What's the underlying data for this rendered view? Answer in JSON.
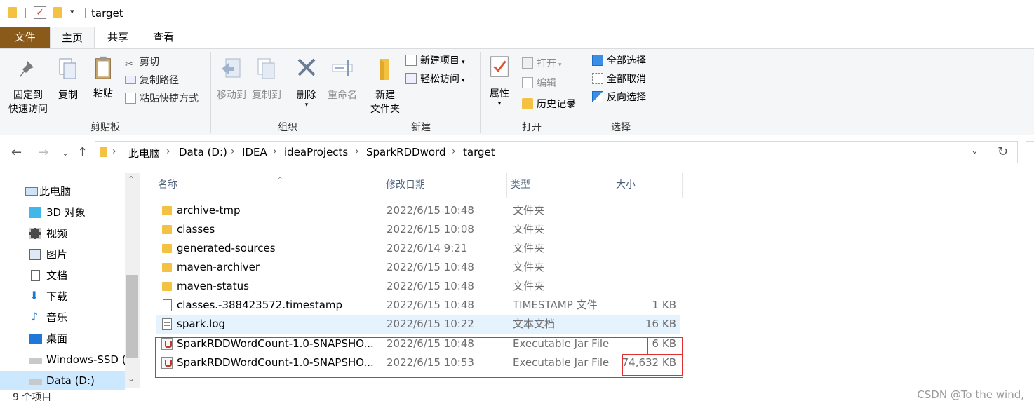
{
  "window": {
    "title": "target"
  },
  "ribbon_tabs": {
    "file": "文件",
    "home": "主页",
    "share": "共享",
    "view": "查看"
  },
  "ribbon": {
    "clipboard": {
      "group_label": "剪贴板",
      "pin_line1": "固定到",
      "pin_line2": "快速访问",
      "copy": "复制",
      "paste": "粘贴",
      "cut": "剪切",
      "copy_path": "复制路径",
      "paste_shortcut": "粘贴快捷方式"
    },
    "organize": {
      "group_label": "组织",
      "move_to": "移动到",
      "copy_to": "复制到",
      "delete": "删除",
      "rename": "重命名"
    },
    "new": {
      "group_label": "新建",
      "new_folder_line1": "新建",
      "new_folder_line2": "文件夹",
      "new_item": "新建项目",
      "easy_access": "轻松访问"
    },
    "open": {
      "group_label": "打开",
      "properties": "属性",
      "open": "打开",
      "edit": "编辑",
      "history": "历史记录"
    },
    "select": {
      "group_label": "选择",
      "select_all": "全部选择",
      "select_none": "全部取消",
      "invert": "反向选择"
    }
  },
  "breadcrumb": [
    "此电脑",
    "Data (D:)",
    "IDEA",
    "ideaProjects",
    "SparkRDDword",
    "target"
  ],
  "nav_pane": [
    {
      "label": "此电脑",
      "icon": "computer-icon"
    },
    {
      "label": "3D 对象",
      "icon": "cube-icon"
    },
    {
      "label": "视频",
      "icon": "video-icon"
    },
    {
      "label": "图片",
      "icon": "picture-icon"
    },
    {
      "label": "文档",
      "icon": "document-icon"
    },
    {
      "label": "下载",
      "icon": "download-icon"
    },
    {
      "label": "音乐",
      "icon": "music-icon"
    },
    {
      "label": "桌面",
      "icon": "desktop-icon"
    },
    {
      "label": "Windows-SSD (",
      "icon": "drive-icon"
    },
    {
      "label": "Data (D:)",
      "icon": "drive-icon"
    }
  ],
  "columns": {
    "name": "名称",
    "date": "修改日期",
    "type": "类型",
    "size": "大小"
  },
  "files": [
    {
      "name": "archive-tmp",
      "date": "2022/6/15 10:48",
      "type": "文件夹",
      "size": "",
      "icon": "folder-icon"
    },
    {
      "name": "classes",
      "date": "2022/6/15 10:08",
      "type": "文件夹",
      "size": "",
      "icon": "folder-icon"
    },
    {
      "name": "generated-sources",
      "date": "2022/6/14 9:21",
      "type": "文件夹",
      "size": "",
      "icon": "folder-icon"
    },
    {
      "name": "maven-archiver",
      "date": "2022/6/15 10:48",
      "type": "文件夹",
      "size": "",
      "icon": "folder-icon"
    },
    {
      "name": "maven-status",
      "date": "2022/6/15 10:48",
      "type": "文件夹",
      "size": "",
      "icon": "folder-icon"
    },
    {
      "name": "classes.-388423572.timestamp",
      "date": "2022/6/15 10:48",
      "type": "TIMESTAMP 文件",
      "size": "1 KB",
      "icon": "file-icon"
    },
    {
      "name": "spark.log",
      "date": "2022/6/15 10:22",
      "type": "文本文档",
      "size": "16 KB",
      "icon": "text-file-icon"
    },
    {
      "name": "SparkRDDWordCount-1.0-SNAPSHO...",
      "date": "2022/6/15 10:48",
      "type": "Executable Jar File",
      "size": "6 KB",
      "icon": "jar-icon"
    },
    {
      "name": "SparkRDDWordCount-1.0-SNAPSHO...",
      "date": "2022/6/15 10:53",
      "type": "Executable Jar File",
      "size": "74,632 KB",
      "icon": "jar-icon"
    }
  ],
  "status": {
    "item_count": "9 个项目"
  },
  "watermark": "CSDN @To the wind,"
}
